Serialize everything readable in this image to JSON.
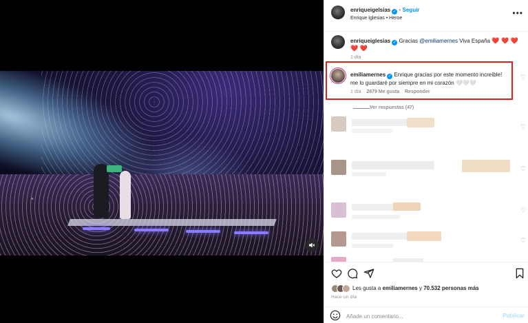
{
  "post": {
    "author": "enriqueigelsias",
    "follow_label": "Seguir",
    "audio_line": "Enrique Iglesias • Heroe",
    "caption_user": "enriqueiglesias",
    "caption_text": "Gracias",
    "caption_mention": "@emiliamernes",
    "caption_text2": "Viva España",
    "caption_hearts_1": "❤️ ❤️ ❤️",
    "caption_hearts_2": "❤️ ❤️",
    "caption_time": "1 día"
  },
  "highlighted_comment": {
    "user": "emiliamernes",
    "text_line1": "Enrique gracias por este momento increíble!",
    "text_line2": "me lo guardaré por siempre en mi corazón 🤍🤍🤍",
    "time": "1 día",
    "likes": "2679 Me gusta",
    "reply_label": "Responder",
    "view_replies": "Ver respuestas (47)"
  },
  "menu_icon": "more-horizontal-icon",
  "likes_line": {
    "prefix": "Les gusta a",
    "user": "emiliamernes",
    "conjunction": "y",
    "others": "70.532 personas más"
  },
  "posted_ago": "Hace un día",
  "comment_box": {
    "placeholder": "Añade un comentario...",
    "publish_label": "Publicar"
  },
  "colors": {
    "accent": "#0095f6",
    "highlight_border": "#e02020",
    "heart": "#ed4956"
  }
}
